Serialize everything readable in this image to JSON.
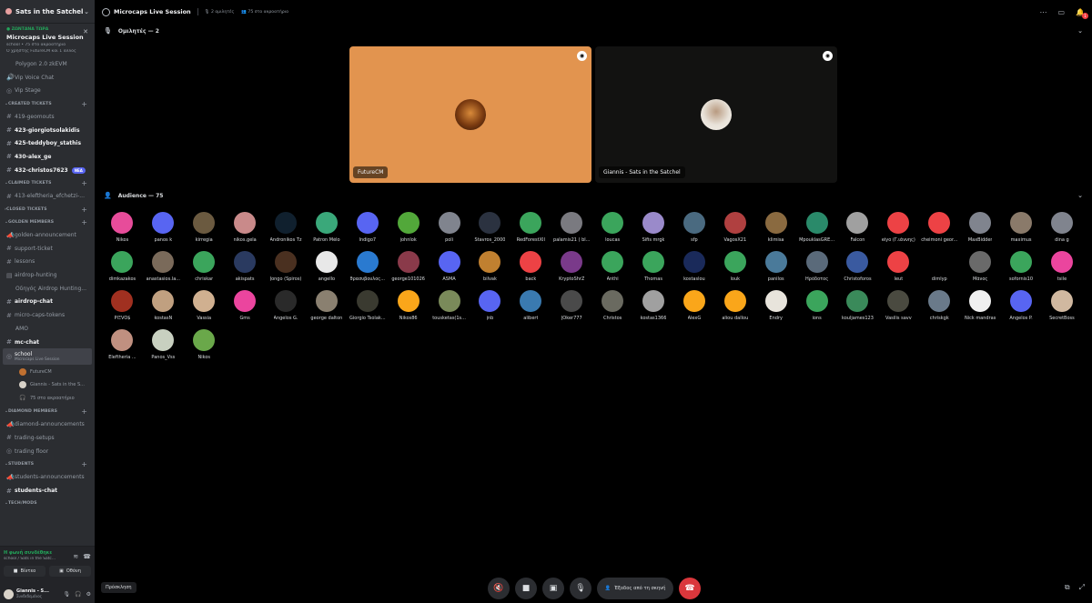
{
  "server": {
    "name": "Sats in the Satchel"
  },
  "live": {
    "tag": "● ΖΩΝΤΑΝΑ ΤΩΡΑ",
    "title": "Microcaps Live Session",
    "meta": "school • 75 στο ακροατήριο",
    "users": "Ο χρήστης FutureCM και 1 άλλος"
  },
  "sidebar": {
    "channels_top": [
      {
        "label": "Polygon 2.0 zkEVM",
        "type": "sub"
      },
      {
        "label": "Vip Voice Chat",
        "type": "voice"
      },
      {
        "label": "Vip Stage",
        "type": "voice"
      }
    ],
    "cat_created": "CREATED TICKETS",
    "created": [
      {
        "label": "419-geomouts",
        "bold": false
      },
      {
        "label": "423-giorgiotsolakidis",
        "bold": true
      },
      {
        "label": "425-teddyboy_stathis",
        "bold": true
      },
      {
        "label": "430-alex_ge",
        "bold": true
      },
      {
        "label": "432-christos7623",
        "bold": true,
        "badge": "NEA"
      }
    ],
    "cat_claimed": "CLAIMED TICKETS",
    "claimed": [
      {
        "label": "413-eleftheria_efchetzi-..."
      }
    ],
    "cat_closed": "CLOSED TICKETS",
    "cat_golden": "GOLDEN MEMBERS",
    "golden": [
      {
        "label": "golden-announcement",
        "bold": false
      },
      {
        "label": "support-ticket",
        "bold": false
      },
      {
        "label": "lessons",
        "bold": false
      },
      {
        "label": "airdrop-hunting",
        "bold": false
      },
      {
        "label": "Οδηγός Airdrop Hunting...",
        "bold": false,
        "sub": true
      },
      {
        "label": "airdrop-chat",
        "bold": true
      },
      {
        "label": "micro-caps-tokens",
        "bold": false
      },
      {
        "label": "AMO",
        "bold": false
      },
      {
        "label": "mc-chat",
        "bold": true
      }
    ],
    "active_channel": {
      "label": "school",
      "sublabel": "Microcaps Live Session"
    },
    "voice_users": [
      {
        "label": "FutureCM"
      },
      {
        "label": "Giannis - Sats in the S..."
      },
      {
        "label": "75 στο ακροατήριο"
      }
    ],
    "cat_diamond": "DIAMOND MEMBERS",
    "diamond": [
      {
        "label": "diamond-announcements"
      },
      {
        "label": "trading-setups"
      },
      {
        "label": "trading floor"
      }
    ],
    "cat_students": "STUDENTS",
    "students": [
      {
        "label": "students-announcements",
        "bold": false
      },
      {
        "label": "students-chat",
        "bold": true
      }
    ],
    "cat_tech": "TECH/MODS"
  },
  "voice_panel": {
    "status": "Η φωνή συνδέθηκε",
    "sub": "school / Sats in the Satc...",
    "video_label": "Βίντεο",
    "screen_label": "Οθόνη"
  },
  "user": {
    "name": "Giannis - S...",
    "status": "Συνδεδεμένος"
  },
  "topbar": {
    "title": "Microcaps Live Session",
    "speakers_meta": "2 ομιλητές",
    "audience_meta": "75 στο ακροατήριο"
  },
  "speakers_header": "Ομιλητές — 2",
  "speakers": [
    {
      "name": "FutureCM",
      "bg": "#e2944f",
      "avatar": "#6b3a18"
    },
    {
      "name": "Giannis - Sats in the Satchel",
      "bg": "#121211",
      "avatar": "#e8e2d9"
    }
  ],
  "audience_header": "Audience — 75",
  "audience": [
    {
      "n": "Nikos",
      "c": "#e74c9a"
    },
    {
      "n": "panos k",
      "c": "#5865f2"
    },
    {
      "n": "kirregia",
      "c": "#6b5a40"
    },
    {
      "n": "nikos.gela",
      "c": "#c98a8a"
    },
    {
      "n": "Andronikos Tz",
      "c": "#10202e"
    },
    {
      "n": "Patron Mélo",
      "c": "#3aa87a"
    },
    {
      "n": "Indigo7",
      "c": "#5865f2"
    },
    {
      "n": "johnlok",
      "c": "#52a83a"
    },
    {
      "n": "poli",
      "c": "#80848e"
    },
    {
      "n": "Stavros_2000",
      "c": "#2b3240"
    },
    {
      "n": "RedForestXII",
      "c": "#3ba55c"
    },
    {
      "n": "palamis21 ( bl...",
      "c": "#7a7a80"
    },
    {
      "n": "loucas",
      "c": "#3ba55c"
    },
    {
      "n": "Sifis mrgk",
      "c": "#9a8aca"
    },
    {
      "n": "sfp",
      "c": "#4a6a80"
    },
    {
      "n": "VagosX21",
      "c": "#b04040"
    },
    {
      "n": "klimisa",
      "c": "#8a6a40"
    },
    {
      "n": "MpouklasGRE...",
      "c": "#2a8a6a"
    },
    {
      "n": "Falcon",
      "c": "#a0a0a0"
    },
    {
      "n": "eiyo (Γ.ιάννης)",
      "c": "#ed4245"
    },
    {
      "n": "cheimoni geor...",
      "c": "#ed4245"
    },
    {
      "n": "MaxBidder",
      "c": "#80848e"
    },
    {
      "n": "maximus",
      "c": "#8a7a6a"
    },
    {
      "n": "dina g",
      "c": "#80848e"
    },
    {
      "n": "dimkazakos",
      "c": "#3ba55c"
    },
    {
      "n": "anastasios.la...",
      "c": "#7a6a5a"
    },
    {
      "n": "chriskar",
      "c": "#3ba55c"
    },
    {
      "n": "akispats",
      "c": "#2a3a60"
    },
    {
      "n": "Jongo (Spiros)",
      "c": "#4a3020"
    },
    {
      "n": "angello",
      "c": "#e8e8e8"
    },
    {
      "n": "θρασυβουλος...",
      "c": "#2a7ad0"
    },
    {
      "n": "george101026",
      "c": "#8a3a4a"
    },
    {
      "n": "ASMA",
      "c": "#5865f2"
    },
    {
      "n": "bilvak",
      "c": "#c08030"
    },
    {
      "n": "back",
      "c": "#ed4245"
    },
    {
      "n": "KryptoShrZ",
      "c": "#7a3a8a"
    },
    {
      "n": "Anthi",
      "c": "#3ba55c"
    },
    {
      "n": "Thomas",
      "c": "#3ba55c"
    },
    {
      "n": "kostaslou",
      "c": "#1a2a5a"
    },
    {
      "n": "louk",
      "c": "#3ba55c"
    },
    {
      "n": "panilos",
      "c": "#4a7a9a"
    },
    {
      "n": "Ηρόδοτος",
      "c": "#5a6a7a"
    },
    {
      "n": "Christoforos",
      "c": "#3a5aa0"
    },
    {
      "n": "leut",
      "c": "#ed4245"
    },
    {
      "n": "dimlyp",
      "c": "#000000"
    },
    {
      "n": "Μάνος",
      "c": "#6a6a6a"
    },
    {
      "n": "sofornis10",
      "c": "#3ba55c"
    },
    {
      "n": "tsile",
      "c": "#eb459e"
    },
    {
      "n": "PlΞVO$",
      "c": "#a03020"
    },
    {
      "n": "kostasN",
      "c": "#c0a080"
    },
    {
      "n": "Vassia",
      "c": "#d0b090"
    },
    {
      "n": "Gms",
      "c": "#eb459e"
    },
    {
      "n": "Angelos G.",
      "c": "#2a2a2a"
    },
    {
      "n": "george dalton",
      "c": "#8a8070"
    },
    {
      "n": "Giorgio Tsolak...",
      "c": "#3a3a30"
    },
    {
      "n": "Nikos86",
      "c": "#faa61a"
    },
    {
      "n": "tousketas(1s...",
      "c": "#7a8a5a"
    },
    {
      "n": "jnb",
      "c": "#5865f2"
    },
    {
      "n": "alibert",
      "c": "#3a7ab0"
    },
    {
      "n": "JOker777",
      "c": "#4a4a4a"
    },
    {
      "n": "Christos",
      "c": "#6a6a60"
    },
    {
      "n": "kostas1366",
      "c": "#a0a0a0"
    },
    {
      "n": "AlexG",
      "c": "#faa61a"
    },
    {
      "n": "aliou dallou",
      "c": "#faa61a"
    },
    {
      "n": "Endry",
      "c": "#e8e4dc"
    },
    {
      "n": "ions",
      "c": "#3ba55c"
    },
    {
      "n": "kouljames123",
      "c": "#3a8a5a"
    },
    {
      "n": "Vasilis savv",
      "c": "#4a4a40"
    },
    {
      "n": "chriskgk",
      "c": "#6a7a8a"
    },
    {
      "n": "Nick mandras",
      "c": "#f0f0f0"
    },
    {
      "n": "Angelos P.",
      "c": "#5865f2"
    },
    {
      "n": "SecretBoss",
      "c": "#d0b8a0"
    },
    {
      "n": "Eleftheria ...",
      "c": "#c09080"
    },
    {
      "n": "Panos_Vss",
      "c": "#c8d0c0"
    },
    {
      "n": "Nikos",
      "c": "#6aa84a"
    }
  ],
  "bottom": {
    "invite_label": "Πρόσκληση",
    "leave_label": "Έξοδος από τη σκηνή"
  },
  "colors": {
    "accent": "#5865f2",
    "online": "#23a55a",
    "danger": "#da373c"
  }
}
